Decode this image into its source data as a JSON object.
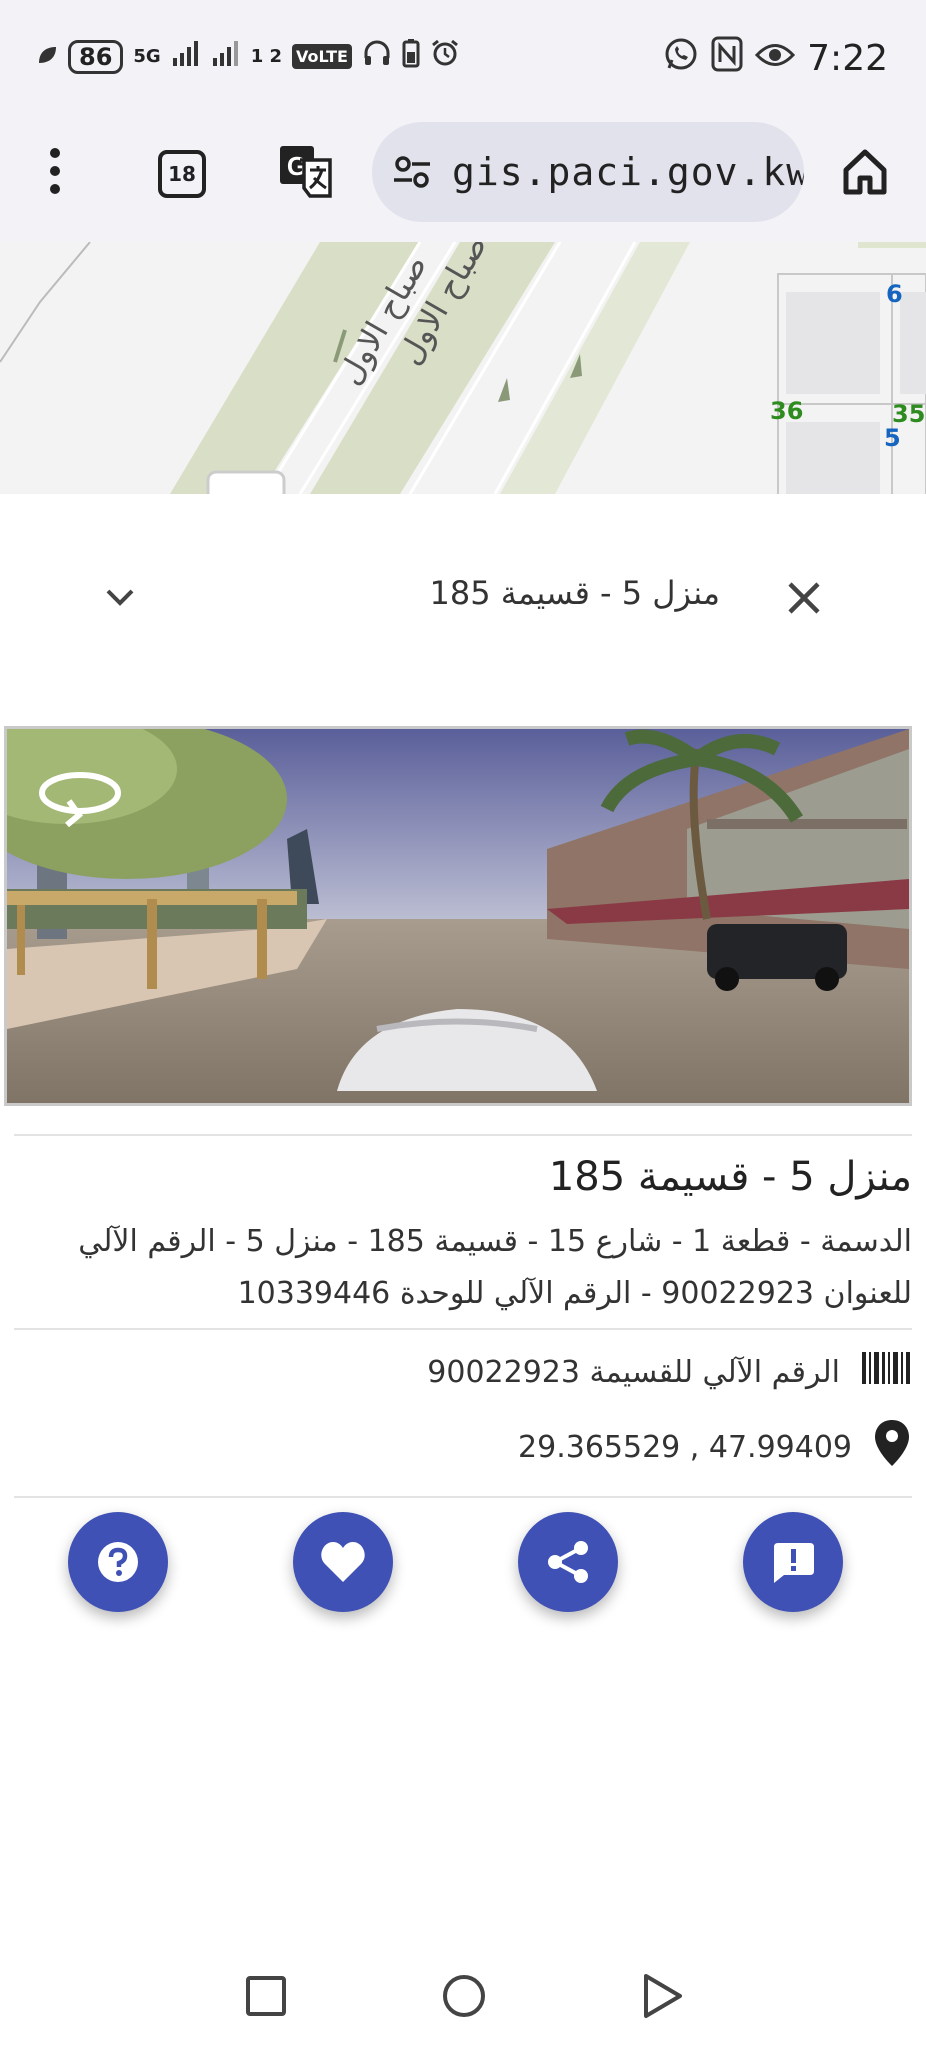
{
  "status_bar": {
    "battery": "86",
    "network_5g": "5G",
    "sim_slot": "1 2",
    "volte": "VoLTE",
    "time": "7:22"
  },
  "browser": {
    "tab_count": "18",
    "url": "gis.paci.gov.kw/Pla"
  },
  "map": {
    "road_label_1": "طريق صباح الاول",
    "road_label_2": "صباح الاول",
    "block_numbers": [
      "6",
      "36",
      "35",
      "5"
    ]
  },
  "sheet": {
    "header_title": "منزل 5 - قسيمة 185",
    "place_name": "منزل 5 - قسيمة 185",
    "address": "الدسمة - قطعة 1 - شارع 15 - قسيمة 185 - منزل 5 - الرقم الآلي للعنوان 90022923 - الرقم الآلي للوحدة 10339446",
    "parcel_number": "الرقم الآلي للقسيمة 90022923",
    "coordinates": "29.365529 , 47.99409"
  },
  "colors": {
    "accent": "#3f51b5",
    "map_road": "#d8dfc6",
    "label_green": "#2e8b1f",
    "label_blue": "#1565c0"
  },
  "icons": {
    "actions": [
      "help-icon",
      "heart-icon",
      "share-icon",
      "feedback-icon"
    ]
  }
}
